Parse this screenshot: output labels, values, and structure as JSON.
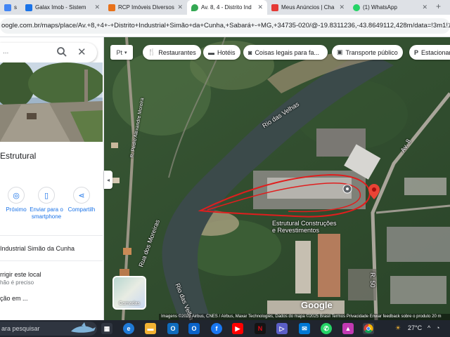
{
  "browser": {
    "tabs": [
      {
        "label": "s",
        "color": "#4285f4",
        "active": false
      },
      {
        "label": "Galax Imob - Sistem",
        "color": "#1a73e8",
        "active": false
      },
      {
        "label": "RCP Imóveis Diversos",
        "color": "#e8711a",
        "active": false
      },
      {
        "label": "Av. 8, 4 - Distrito Ind",
        "color": "#34a853",
        "active": true
      },
      {
        "label": "Meus Anúncios | Cha",
        "color": "#e53935",
        "active": false
      },
      {
        "label": "(1) WhatsApp",
        "color": "#25d366",
        "active": false
      }
    ],
    "new_tab_label": "+",
    "url": "oogle.com.br/maps/place/Av.+8,+4+-+Distrito+Industrial+Simão+da+Cunha,+Sabará+-+MG,+34735-020/@-19.8311236,-43.8649112,428m/data=!3m1!1e3!4"
  },
  "panel": {
    "search_query": "...",
    "place_title": "Estrutural",
    "actions": [
      {
        "label": "Próximo",
        "icon": "nearby-icon"
      },
      {
        "label": "Enviar para o smartphone",
        "icon": "phone-icon"
      },
      {
        "label": "Compartilh",
        "icon": "share-icon"
      }
    ],
    "address_line": "Industrial Simão da Cunha",
    "suggest_edit": "rrigir este local",
    "suggest_edit_sub": "hão é preciso",
    "add_label": "ção em ..."
  },
  "map": {
    "layer_button": "Pt",
    "chips": [
      {
        "label": "Restaurantes",
        "icon": "fork-knife-icon"
      },
      {
        "label": "Hotéis",
        "icon": "bed-icon"
      },
      {
        "label": "Coisas legais para fa...",
        "icon": "camera-icon"
      },
      {
        "label": "Transporte público",
        "icon": "bus-icon"
      },
      {
        "label": "Estacionar",
        "icon": "parking-icon"
      }
    ],
    "labels": {
      "river_top": "Rio das Velhas",
      "river_bottom": "Rio das Velhas",
      "street_left": "Rua dos Moreiras",
      "street_left2": "R. Pedro Alexandre Moreira",
      "street_right": "Av. 8",
      "street_bottom": "R. 50",
      "poi_name_line1": "Estrutural Construções",
      "poi_name_line2": "e Revestimentos"
    },
    "layers_label": "Camadas",
    "google_watermark": "Google",
    "attribution": "Imagens ©2025 Airbus, CNES / Airbus, Maxar Technologies, Dados do mapa ©2025   Brasil   Termos   Privacidade   Enviar feedback sobre o produto   20 m",
    "annotation_color": "#e01e1e",
    "pin_color": "#ea4335"
  },
  "taskbar": {
    "search_placeholder": "ara pesquisar",
    "weather": "27°C",
    "apps": [
      "task-view",
      "edge",
      "explorer",
      "outlook",
      "facebook",
      "youtube",
      "netflix",
      "media",
      "mail",
      "whatsapp",
      "photos",
      "chrome"
    ]
  }
}
